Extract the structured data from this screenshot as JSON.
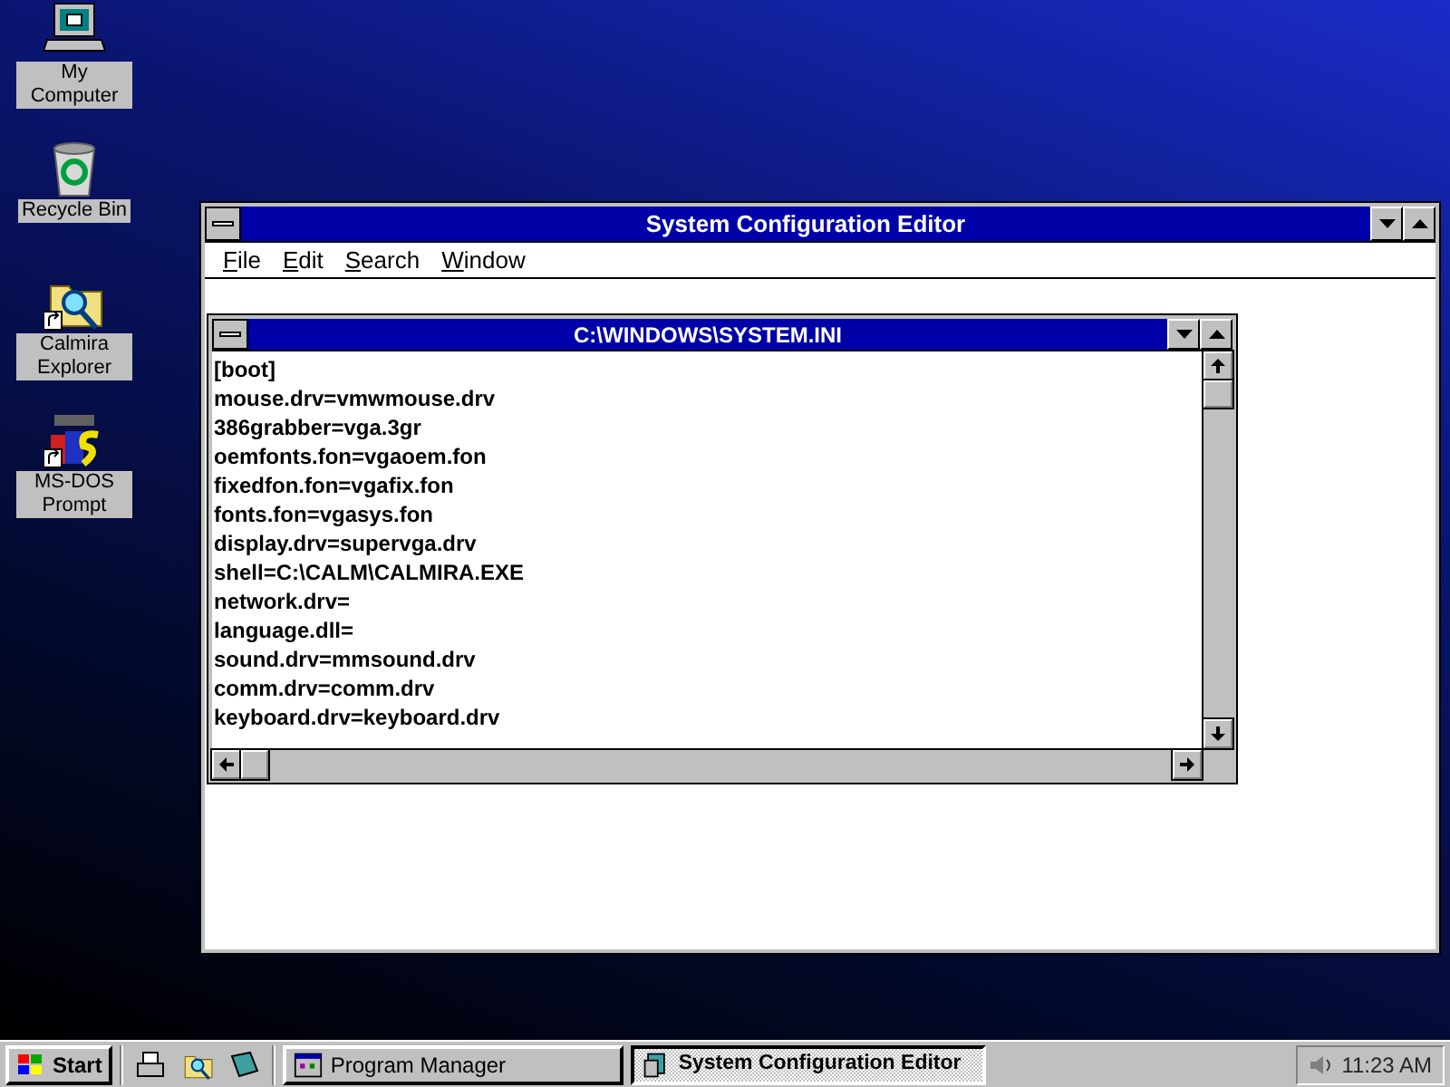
{
  "desktop_icons": [
    {
      "label": "My Computer",
      "kind": "computer",
      "shortcut": false
    },
    {
      "label": "Recycle Bin",
      "kind": "bin",
      "shortcut": false
    },
    {
      "label": "Calmira Explorer",
      "kind": "explorer",
      "shortcut": true
    },
    {
      "label": "MS-DOS Prompt",
      "kind": "msdos",
      "shortcut": true
    }
  ],
  "window": {
    "title": "System Configuration Editor",
    "menu": [
      "File",
      "Edit",
      "Search",
      "Window"
    ],
    "document": {
      "title": "C:\\WINDOWS\\SYSTEM.INI",
      "lines": [
        "[boot]",
        "mouse.drv=vmwmouse.drv",
        "386grabber=vga.3gr",
        "oemfonts.fon=vgaoem.fon",
        "fixedfon.fon=vgafix.fon",
        "fonts.fon=vgasys.fon",
        "display.drv=supervga.drv",
        "shell=C:\\CALM\\CALMIRA.EXE",
        "network.drv=",
        "language.dll=",
        "sound.drv=mmsound.drv",
        "comm.drv=comm.drv",
        "keyboard.drv=keyboard.drv"
      ]
    }
  },
  "taskbar": {
    "start": "Start",
    "quick_launch": [
      {
        "kind": "printer"
      },
      {
        "kind": "explorer"
      },
      {
        "kind": "book"
      }
    ],
    "tasks": [
      {
        "label": "Program Manager",
        "kind": "progman",
        "selected": false
      },
      {
        "label": "System Configuration Editor",
        "kind": "sysedit",
        "selected": true
      }
    ],
    "clock": "11:23 AM"
  }
}
